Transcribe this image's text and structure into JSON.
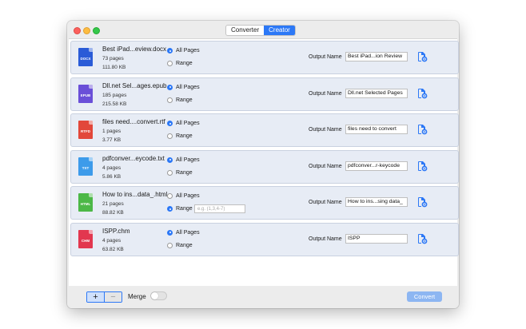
{
  "window": {
    "tabs": [
      {
        "label": "Converter",
        "active": false
      },
      {
        "label": "Creator",
        "active": true
      }
    ]
  },
  "labels": {
    "all_pages": "All Pages",
    "range": "Range",
    "output_name": "Output Name",
    "range_placeholder": "e.g. (1,3,4-7)"
  },
  "files": [
    {
      "type_label": "DOCX",
      "icon_color": "#2a5bd7",
      "name": "Best iPad...eview.docx",
      "pages": "73 pages",
      "size": "111.80 KB",
      "selected": "all",
      "output_name": "Best iPad...ion Review"
    },
    {
      "type_label": "EPUB",
      "icon_color": "#6a4fd8",
      "name": "Dll.net Sel...ages.epub",
      "pages": "185 pages",
      "size": "215.58 KB",
      "selected": "all",
      "output_name": "Dll.net Selected Pages"
    },
    {
      "type_label": "RTFD",
      "icon_color": "#e2473a",
      "name": "files need....convert.rtf",
      "pages": "1 pages",
      "size": "3.77 KB",
      "selected": "all",
      "output_name": "files need to convert"
    },
    {
      "type_label": "TXT",
      "icon_color": "#3d9bea",
      "name": "pdfconver...eycode.txt",
      "pages": "4 pages",
      "size": "5.86 KB",
      "selected": "all",
      "output_name": "pdfconver...r-keycode"
    },
    {
      "type_label": "HTML",
      "icon_color": "#4cb847",
      "name": "How to ins...data_.html",
      "pages": "21 pages",
      "size": "88.82 KB",
      "selected": "range",
      "output_name": "How to ins...sing data_"
    },
    {
      "type_label": "CHM",
      "icon_color": "#e2374f",
      "name": "ISPP.chm",
      "pages": "4 pages",
      "size": "63.82 KB",
      "selected": "all",
      "output_name": "ISPP"
    }
  ],
  "bottom": {
    "add_label": "+",
    "remove_label": "−",
    "merge_label": "Merge",
    "merge_on": false,
    "convert_label": "Convert"
  },
  "colors": {
    "accent": "#2c78f6",
    "gear": "#2c78f6"
  }
}
